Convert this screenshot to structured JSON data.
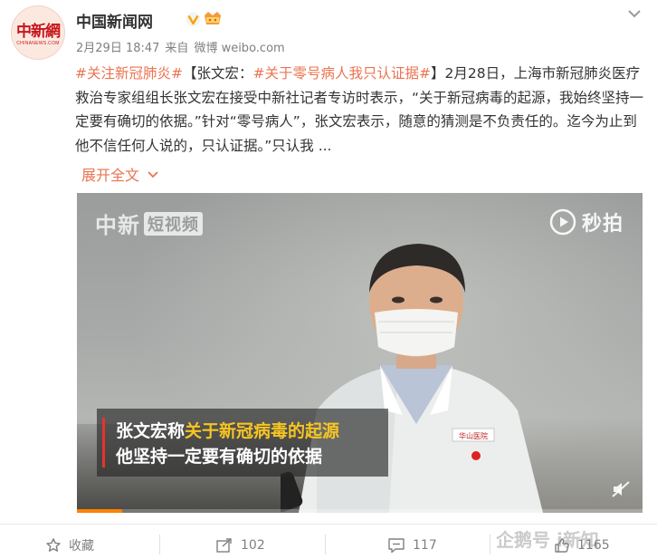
{
  "colors": {
    "accent": "#eb7350",
    "progress": "#ff8200",
    "caption_highlight": "#f7c522",
    "caption_bar": "#e9322c",
    "logo_red": "#c8161d"
  },
  "header": {
    "avatar_text": "中新網",
    "avatar_subtext": "CHINANEWS.COM",
    "user_name": "中国新闻网",
    "verified_icon": "verified-v-icon",
    "vip_icon": "vip-crown-icon",
    "time": "2月29日 18:47",
    "source_prefix": "来自",
    "source_name": "微博 weibo.com"
  },
  "post": {
    "tag1": "#关注新冠肺炎#",
    "bracket_open": "【张文宏：",
    "tag2": "#关于零号病人我只认证据#",
    "bracket_close": "】",
    "body": "2月28日，上海市新冠肺炎医疗救治专家组组长张文宏在接受中新社记者专访时表示，“关于新冠病毒的起源，我始终坚持一定要有确切的依据。”针对“零号病人”，张文宏表示，随意的猜测是不负责任的。迄今为止到他不信任何人说的，只认证据。”只认我 ...",
    "expand_label": "展开全文",
    "expand_icon": "chevron-down-icon"
  },
  "video": {
    "watermark_left": "中新",
    "watermark_left_box": "短视频",
    "watermark_right": "秒拍",
    "caption_line1_prefix": "张文宏称",
    "caption_line1_highlight": "关于新冠病毒的起源",
    "caption_line2": "他坚持一定要有确切的依据",
    "badge_text": "华山医院",
    "progress": 0.08,
    "mute_icon": "volume-mute-icon"
  },
  "actions": [
    {
      "icon": "star-icon",
      "label": "收藏"
    },
    {
      "icon": "share-icon",
      "label": "102"
    },
    {
      "icon": "comment-icon",
      "label": "117"
    },
    {
      "icon": "thumbs-up-icon",
      "label": "1165"
    }
  ],
  "brand_watermark": "企鹅号 i新知"
}
